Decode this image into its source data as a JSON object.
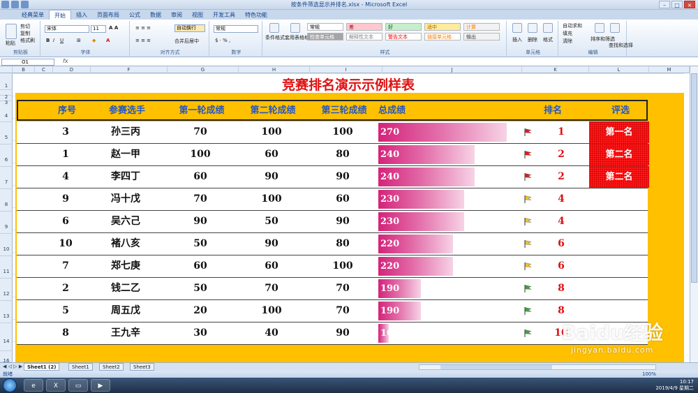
{
  "window": {
    "title": "按条件筛选显示并排名.xlsx - Microsoft Excel"
  },
  "ribbon": {
    "tabs": [
      "经典菜单",
      "开始",
      "插入",
      "页面布局",
      "公式",
      "数据",
      "审阅",
      "视图",
      "开发工具",
      "特色功能"
    ],
    "active_tab": "开始",
    "clipboard": {
      "paste": "粘贴",
      "cut": "剪切",
      "copy": "复制",
      "painter": "格式刷",
      "label": "剪贴板"
    },
    "font": {
      "name": "宋体",
      "size": "11",
      "label": "字体"
    },
    "align": {
      "wrap": "自动换行",
      "merge": "合并后居中",
      "label": "对齐方式"
    },
    "number": {
      "format": "常规",
      "label": "数字"
    },
    "styles": {
      "cond": "条件格式",
      "table": "套用表格格式",
      "cells": [
        "常规",
        "差",
        "好",
        "适中",
        "计算",
        "检查单元格",
        "解释性文本",
        "警告文本",
        "链接单元格",
        "输出"
      ],
      "label": "样式"
    },
    "cells_group": {
      "insert": "插入",
      "delete": "删除",
      "format": "格式",
      "label": "单元格"
    },
    "edit": {
      "autosum": "自动求和",
      "fill": "填充",
      "clear": "清除",
      "sort": "排序和筛选",
      "find": "查找和选择",
      "label": "编辑"
    }
  },
  "formula_bar": {
    "name_box": "O1",
    "fx": "fx"
  },
  "columns": [
    "B",
    "C",
    "D",
    "F",
    "G",
    "H",
    "I",
    "J",
    "K",
    "L",
    "M"
  ],
  "rows": [
    "1",
    "2",
    "3",
    "4",
    "5",
    "6",
    "7",
    "8",
    "9",
    "10",
    "11",
    "12",
    "13",
    "14",
    "16"
  ],
  "sheet": {
    "title": "竞赛排名演示示例样表",
    "headers": [
      "序号",
      "参赛选手",
      "第一轮成绩",
      "第二轮成绩",
      "第三轮成绩",
      "总成绩",
      "排名",
      "评选"
    ],
    "rows": [
      {
        "no": "3",
        "name": "孙三丙",
        "r1": "70",
        "r2": "100",
        "r3": "100",
        "total": 270,
        "rank": "1",
        "flag": "red",
        "award": "第一名"
      },
      {
        "no": "1",
        "name": "赵一甲",
        "r1": "100",
        "r2": "60",
        "r3": "80",
        "total": 240,
        "rank": "2",
        "flag": "red",
        "award": "第二名"
      },
      {
        "no": "4",
        "name": "李四丁",
        "r1": "60",
        "r2": "90",
        "r3": "90",
        "total": 240,
        "rank": "2",
        "flag": "red",
        "award": "第二名"
      },
      {
        "no": "9",
        "name": "冯十戊",
        "r1": "70",
        "r2": "100",
        "r3": "60",
        "total": 230,
        "rank": "4",
        "flag": "yellow",
        "award": ""
      },
      {
        "no": "6",
        "name": "吴六己",
        "r1": "90",
        "r2": "50",
        "r3": "90",
        "total": 230,
        "rank": "4",
        "flag": "yellow",
        "award": ""
      },
      {
        "no": "10",
        "name": "褚八亥",
        "r1": "50",
        "r2": "90",
        "r3": "80",
        "total": 220,
        "rank": "6",
        "flag": "yellow",
        "award": ""
      },
      {
        "no": "7",
        "name": "郑七庚",
        "r1": "60",
        "r2": "60",
        "r3": "100",
        "total": 220,
        "rank": "6",
        "flag": "yellow",
        "award": ""
      },
      {
        "no": "2",
        "name": "钱二乙",
        "r1": "50",
        "r2": "70",
        "r3": "70",
        "total": 190,
        "rank": "8",
        "flag": "green",
        "award": ""
      },
      {
        "no": "5",
        "name": "周五戊",
        "r1": "20",
        "r2": "100",
        "r3": "70",
        "total": 190,
        "rank": "8",
        "flag": "green",
        "award": ""
      },
      {
        "no": "8",
        "name": "王九辛",
        "r1": "30",
        "r2": "40",
        "r3": "90",
        "total": 160,
        "rank": "10",
        "flag": "green",
        "award": ""
      }
    ],
    "bar_scale": {
      "min": 150,
      "max": 270
    },
    "colors": {
      "title": "#e01010",
      "frame": "#ffc000",
      "header_text": "#2457c5",
      "bar": "#d4237a",
      "rank": "#e01010",
      "award_bg": "#ff1a1a",
      "flag_red": "#d81e1e",
      "flag_yellow": "#f2c21b",
      "flag_green": "#3aa63a"
    }
  },
  "sheet_tabs": [
    "Sheet1 (2)",
    "Sheet1",
    "Sheet2",
    "Sheet3"
  ],
  "active_sheet": "Sheet1 (2)",
  "status": {
    "ready": "就绪",
    "zoom": "100%"
  },
  "taskbar": {
    "time": "10:17",
    "date": "2019/4/9 星期二"
  },
  "watermark": {
    "brand": "Baidu经验",
    "url": "jingyan.baidu.com"
  }
}
